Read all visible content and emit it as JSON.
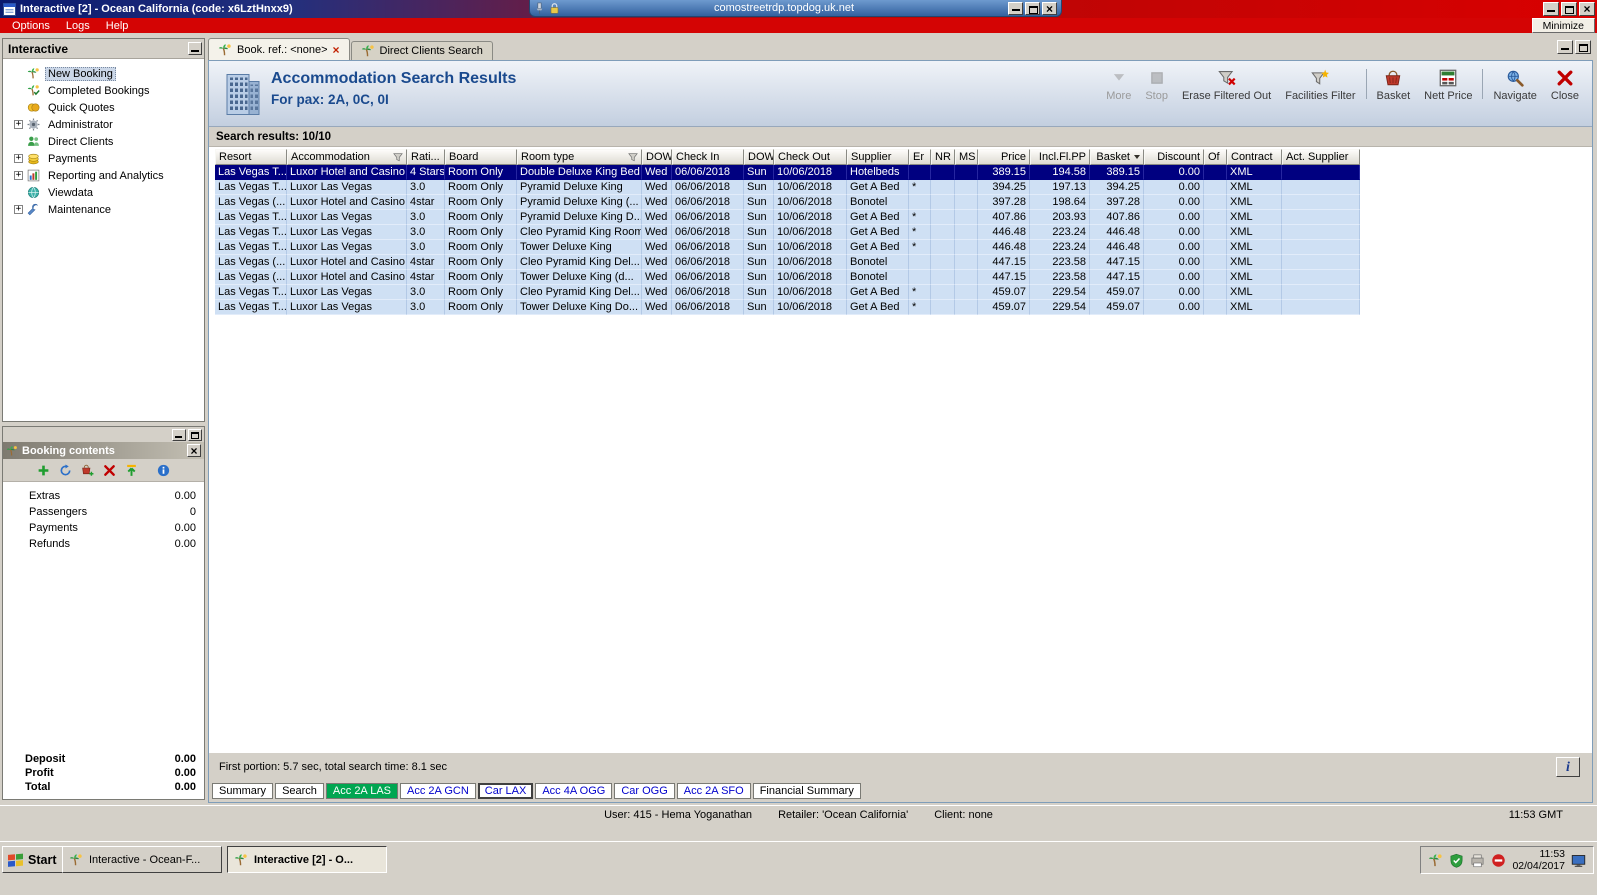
{
  "colors": {
    "titlebar_left": "#0a1a6e",
    "titlebar_right": "#d90000",
    "menu_bar": "#d40404",
    "header_text": "#1a4a8e",
    "row_bg": "#cfe0f4",
    "selected_row_bg": "#000080",
    "tab_green": "#00a651",
    "link_blue": "#0000cc"
  },
  "rdp_bar": {
    "host": "comostreetrdp.topdog.uk.net",
    "buttons": [
      "minimize",
      "restore",
      "close"
    ]
  },
  "window": {
    "title": "Interactive [2] - Ocean California (code: x6LztHnxx9)",
    "menu_items": [
      "Options",
      "Logs",
      "Help"
    ],
    "minimize_button_label": "Minimize",
    "buttons": [
      "minimize",
      "restore",
      "close"
    ]
  },
  "sidebar": {
    "title": "Interactive",
    "items": [
      {
        "label": "New Booking",
        "icon": "new-booking-icon",
        "selected": true
      },
      {
        "label": "Completed Bookings",
        "icon": "completed-bookings-icon"
      },
      {
        "label": "Quick Quotes",
        "icon": "quick-quotes-icon"
      },
      {
        "label": "Administrator",
        "icon": "administrator-icon",
        "expandable": true
      },
      {
        "label": "Direct Clients",
        "icon": "direct-clients-icon"
      },
      {
        "label": "Payments",
        "icon": "payments-icon",
        "expandable": true
      },
      {
        "label": "Reporting and Analytics",
        "icon": "reporting-icon",
        "expandable": true
      },
      {
        "label": "Viewdata",
        "icon": "viewdata-icon"
      },
      {
        "label": "Maintenance",
        "icon": "maintenance-icon",
        "expandable": true
      }
    ]
  },
  "booking_contents": {
    "title": "Booking contents",
    "toolbar_icons": [
      "add-icon",
      "refresh-icon",
      "add-to-basket-icon",
      "delete-icon",
      "transfer-icon",
      "info-icon"
    ],
    "rows": [
      {
        "label": "Extras",
        "value": "0.00"
      },
      {
        "label": "Passengers",
        "value": "0"
      },
      {
        "label": "Payments",
        "value": "0.00"
      },
      {
        "label": "Refunds",
        "value": "0.00"
      }
    ],
    "totals": [
      {
        "label": "Deposit",
        "value": "0.00"
      },
      {
        "label": "Profit",
        "value": "0.00"
      },
      {
        "label": "Total",
        "value": "0.00"
      }
    ]
  },
  "document_tabs": [
    {
      "label": "Book. ref.: <none>",
      "active": true,
      "closable": true
    },
    {
      "label": "Direct Clients Search",
      "active": false
    }
  ],
  "results_header": {
    "title": "Accommodation Search Results",
    "subtitle": "For pax: 2A, 0C, 0I",
    "buttons": [
      {
        "label": "More",
        "icon": "more-icon",
        "disabled": true
      },
      {
        "label": "Stop",
        "icon": "stop-icon",
        "disabled": true
      },
      {
        "label": "Erase Filtered Out",
        "icon": "erase-filter-icon"
      },
      {
        "label": "Facilities Filter",
        "icon": "facilities-filter-icon"
      },
      {
        "label": "Basket",
        "icon": "basket-icon"
      },
      {
        "label": "Nett Price",
        "icon": "nett-price-icon"
      },
      {
        "label": "Navigate",
        "icon": "navigate-icon"
      },
      {
        "label": "Close",
        "icon": "close-icon"
      }
    ]
  },
  "results_count": "Search results: 10/10",
  "table": {
    "columns": [
      {
        "label": "Resort"
      },
      {
        "label": "Accommodation",
        "filter": true
      },
      {
        "label": "Rati..."
      },
      {
        "label": "Board"
      },
      {
        "label": "Room type",
        "filter": true
      },
      {
        "label": "DOW"
      },
      {
        "label": "Check In"
      },
      {
        "label": "DOW"
      },
      {
        "label": "Check Out"
      },
      {
        "label": "Supplier"
      },
      {
        "label": "Er"
      },
      {
        "label": "NR"
      },
      {
        "label": "MS"
      },
      {
        "label": "Price",
        "align": "right"
      },
      {
        "label": "Incl.Fl.PP",
        "align": "right"
      },
      {
        "label": "Basket",
        "align": "right",
        "sort": true
      },
      {
        "label": "Discount",
        "align": "right"
      },
      {
        "label": "Of"
      },
      {
        "label": "Contract"
      },
      {
        "label": "Act. Supplier"
      }
    ],
    "selected_row": 0,
    "rows": [
      [
        "Las Vegas T...",
        "Luxor Hotel and Casino",
        "4 Stars",
        "Room Only",
        "Double Deluxe King Bed",
        "Wed",
        "06/06/2018",
        "Sun",
        "10/06/2018",
        "Hotelbeds",
        "",
        "",
        "",
        "389.15",
        "194.58",
        "389.15",
        "0.00",
        "",
        "XML",
        ""
      ],
      [
        "Las Vegas T...",
        "Luxor Las Vegas",
        "3.0",
        "Room Only",
        "Pyramid Deluxe King",
        "Wed",
        "06/06/2018",
        "Sun",
        "10/06/2018",
        "Get A Bed",
        "*",
        "",
        "",
        "394.25",
        "197.13",
        "394.25",
        "0.00",
        "",
        "XML",
        ""
      ],
      [
        "Las Vegas (...",
        "Luxor Hotel and Casino",
        "4star",
        "Room Only",
        "Pyramid Deluxe King (...",
        "Wed",
        "06/06/2018",
        "Sun",
        "10/06/2018",
        "Bonotel",
        "",
        "",
        "",
        "397.28",
        "198.64",
        "397.28",
        "0.00",
        "",
        "XML",
        ""
      ],
      [
        "Las Vegas T...",
        "Luxor Las Vegas",
        "3.0",
        "Room Only",
        "Pyramid Deluxe King D...",
        "Wed",
        "06/06/2018",
        "Sun",
        "10/06/2018",
        "Get A Bed",
        "*",
        "",
        "",
        "407.86",
        "203.93",
        "407.86",
        "0.00",
        "",
        "XML",
        ""
      ],
      [
        "Las Vegas T...",
        "Luxor Las Vegas",
        "3.0",
        "Room Only",
        "Cleo Pyramid King Room",
        "Wed",
        "06/06/2018",
        "Sun",
        "10/06/2018",
        "Get A Bed",
        "*",
        "",
        "",
        "446.48",
        "223.24",
        "446.48",
        "0.00",
        "",
        "XML",
        ""
      ],
      [
        "Las Vegas T...",
        "Luxor Las Vegas",
        "3.0",
        "Room Only",
        "Tower Deluxe King",
        "Wed",
        "06/06/2018",
        "Sun",
        "10/06/2018",
        "Get A Bed",
        "*",
        "",
        "",
        "446.48",
        "223.24",
        "446.48",
        "0.00",
        "",
        "XML",
        ""
      ],
      [
        "Las Vegas (...",
        "Luxor Hotel and Casino",
        "4star",
        "Room Only",
        "Cleo Pyramid King Del...",
        "Wed",
        "06/06/2018",
        "Sun",
        "10/06/2018",
        "Bonotel",
        "",
        "",
        "",
        "447.15",
        "223.58",
        "447.15",
        "0.00",
        "",
        "XML",
        ""
      ],
      [
        "Las Vegas (...",
        "Luxor Hotel and Casino",
        "4star",
        "Room Only",
        "Tower Deluxe King (d...",
        "Wed",
        "06/06/2018",
        "Sun",
        "10/06/2018",
        "Bonotel",
        "",
        "",
        "",
        "447.15",
        "223.58",
        "447.15",
        "0.00",
        "",
        "XML",
        ""
      ],
      [
        "Las Vegas T...",
        "Luxor Las Vegas",
        "3.0",
        "Room Only",
        "Cleo Pyramid King Del...",
        "Wed",
        "06/06/2018",
        "Sun",
        "10/06/2018",
        "Get A Bed",
        "*",
        "",
        "",
        "459.07",
        "229.54",
        "459.07",
        "0.00",
        "",
        "XML",
        ""
      ],
      [
        "Las Vegas T...",
        "Luxor Las Vegas",
        "3.0",
        "Room Only",
        "Tower Deluxe King Do...",
        "Wed",
        "06/06/2018",
        "Sun",
        "10/06/2018",
        "Get A Bed",
        "*",
        "",
        "",
        "459.07",
        "229.54",
        "459.07",
        "0.00",
        "",
        "XML",
        ""
      ]
    ]
  },
  "status_strip": "First portion: 5.7 sec, total search time: 8.1 sec",
  "bottom_tabs": [
    {
      "label": "Summary",
      "style": "plain"
    },
    {
      "label": "Search",
      "style": "plain"
    },
    {
      "label": "Acc 2A LAS",
      "style": "green"
    },
    {
      "label": "Acc 2A GCN",
      "style": "blue"
    },
    {
      "label": "Car LAX",
      "style": "blue-selected"
    },
    {
      "label": "Acc 4A OGG",
      "style": "blue"
    },
    {
      "label": "Car OGG",
      "style": "blue"
    },
    {
      "label": "Acc 2A SFO",
      "style": "blue"
    },
    {
      "label": "Financial Summary",
      "style": "plain"
    }
  ],
  "status_bar": {
    "segments": [
      "User: 415 - Hema Yoganathan",
      "Retailer: 'Ocean California'",
      "Client: none"
    ],
    "time": "11:53 GMT"
  },
  "taskbar": {
    "start_label": "Start",
    "tasks": [
      {
        "label": "Interactive - Ocean-F...",
        "active": false
      },
      {
        "label": "Interactive [2] - O...",
        "active": true
      }
    ],
    "tray_icons": [
      "tray-palm-icon",
      "tray-shield-icon",
      "tray-printer-icon",
      "tray-alert-icon"
    ],
    "clock_time": "11:53",
    "clock_date": "02/04/2017"
  }
}
